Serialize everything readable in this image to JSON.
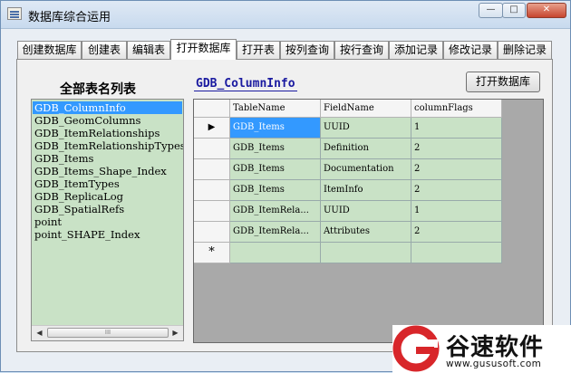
{
  "window": {
    "title": "数据库综合运用",
    "controls": {
      "minimize": "—",
      "maximize": "□",
      "close": "✕"
    }
  },
  "tabs": [
    {
      "label": "创建数据库",
      "active": false
    },
    {
      "label": "创建表",
      "active": false
    },
    {
      "label": "编辑表",
      "active": false
    },
    {
      "label": "打开数据库",
      "active": true
    },
    {
      "label": "打开表",
      "active": false
    },
    {
      "label": "按列查询",
      "active": false
    },
    {
      "label": "按行查询",
      "active": false
    },
    {
      "label": "添加记录",
      "active": false
    },
    {
      "label": "修改记录",
      "active": false
    },
    {
      "label": "删除记录",
      "active": false
    }
  ],
  "left_panel": {
    "title": "全部表名列表",
    "items": [
      "GDB_ColumnInfo",
      "GDB_GeomColumns",
      "GDB_ItemRelationships",
      "GDB_ItemRelationshipTypes",
      "GDB_Items",
      "GDB_Items_Shape_Index",
      "GDB_ItemTypes",
      "GDB_ReplicaLog",
      "GDB_SpatialRefs",
      "point",
      "point_SHAPE_Index"
    ],
    "selected_index": 0,
    "scroll": {
      "left": "◀",
      "right": "▶",
      "thumb": "III"
    }
  },
  "right_panel": {
    "table_name": "GDB_ColumnInfo",
    "open_button": "打开数据库"
  },
  "grid": {
    "columns": [
      "TableName",
      "FieldName",
      "columnFlags"
    ],
    "rows": [
      {
        "marker": "▶",
        "cells": [
          "GDB_Items",
          "UUID",
          "1"
        ]
      },
      {
        "marker": "",
        "cells": [
          "GDB_Items",
          "Definition",
          "2"
        ]
      },
      {
        "marker": "",
        "cells": [
          "GDB_Items",
          "Documentation",
          "2"
        ]
      },
      {
        "marker": "",
        "cells": [
          "GDB_Items",
          "ItemInfo",
          "2"
        ]
      },
      {
        "marker": "",
        "cells": [
          "GDB_ItemRela...",
          "UUID",
          "1"
        ]
      },
      {
        "marker": "",
        "cells": [
          "GDB_ItemRela...",
          "Attributes",
          "2"
        ]
      }
    ],
    "new_row_marker": "*"
  },
  "watermark": {
    "name": "谷速软件",
    "url": "www.gususoft.com"
  }
}
